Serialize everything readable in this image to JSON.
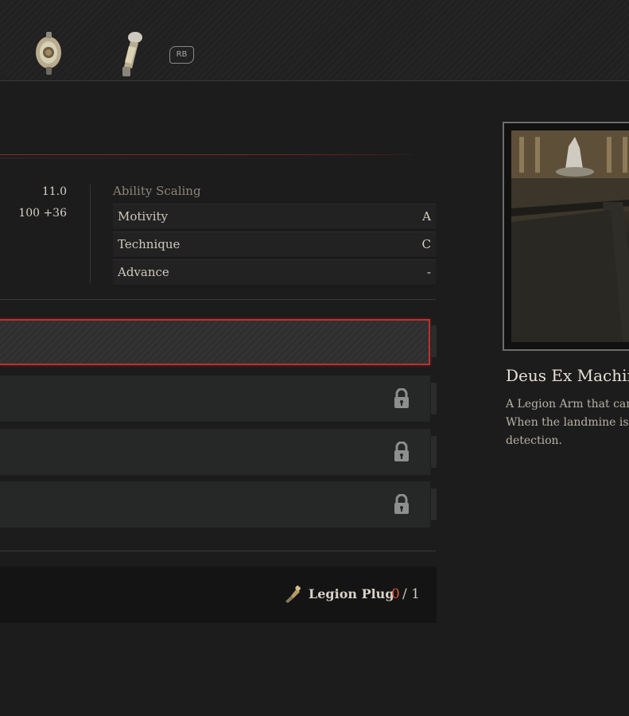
{
  "top_bar": {
    "rb_label": "RB",
    "icons": [
      "legion-arm-icon",
      "legion-arm-icon-2"
    ]
  },
  "stats": {
    "value_1": "11.0",
    "value_2": "100 +36"
  },
  "ability_scaling": {
    "title": "Ability Scaling",
    "rows": [
      {
        "label": "Motivity",
        "grade": "A"
      },
      {
        "label": "Technique",
        "grade": "C"
      },
      {
        "label": "Advance",
        "grade": "-"
      }
    ]
  },
  "slots": [
    {
      "state": "selected"
    },
    {
      "state": "locked",
      "icon": "lock-icon"
    },
    {
      "state": "locked",
      "icon": "lock-icon"
    },
    {
      "state": "locked",
      "icon": "lock-icon"
    }
  ],
  "material": {
    "name": "Legion Plug",
    "have": "0",
    "separator": "/ 1",
    "icon": "legion-plug-icon"
  },
  "item": {
    "title": "Deus Ex Machina",
    "description_lines": [
      "A Legion Arm that can",
      "When the landmine is b",
      "detection."
    ]
  },
  "colors": {
    "accent_red": "#c0302e",
    "count_orange": "#d95a3a"
  }
}
